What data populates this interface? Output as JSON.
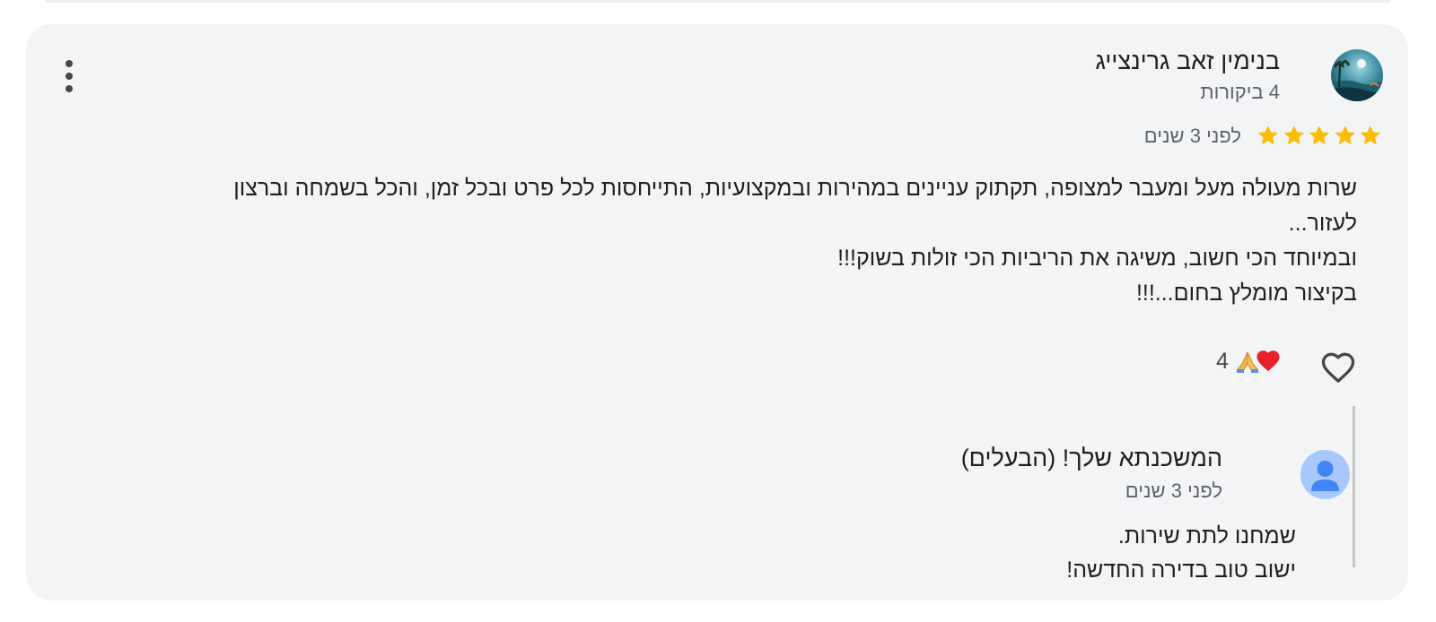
{
  "review": {
    "author_name": "בנימין זאב גרינצייג",
    "author_meta": "4 ביקורות",
    "rating": 5,
    "star_color": "#fbbc04",
    "date": "לפני 3 שנים",
    "text_lines": [
      "שרות מעולה מעל ומעבר למצופה, תקתוק עניינים במהירות ובמקצועיות, התייחסות לכל פרט ובכל זמן, והכל בשמחה וברצון",
      "לעזור...",
      "ובמיוחד הכי חשוב, משיגה את הריביות הכי זולות בשוק!!!",
      "בקיצור מומלץ בחום...!!!"
    ],
    "reaction_count": "4",
    "reaction_icons": [
      "heart-emoji-icon",
      "folded-hands-emoji-icon"
    ],
    "like_icon": "heart-outline-icon",
    "menu_icon": "more-vert-icon"
  },
  "owner_response": {
    "name": "המשכנתא שלך! (הבעלים)",
    "date": "לפני 3 שנים",
    "avatar_color": "#a8c7fa",
    "avatar_figure_color": "#4285f4",
    "text_lines": [
      "שמחנו לתת שירות.",
      "ישוב טוב בדירה החדשה!"
    ]
  }
}
